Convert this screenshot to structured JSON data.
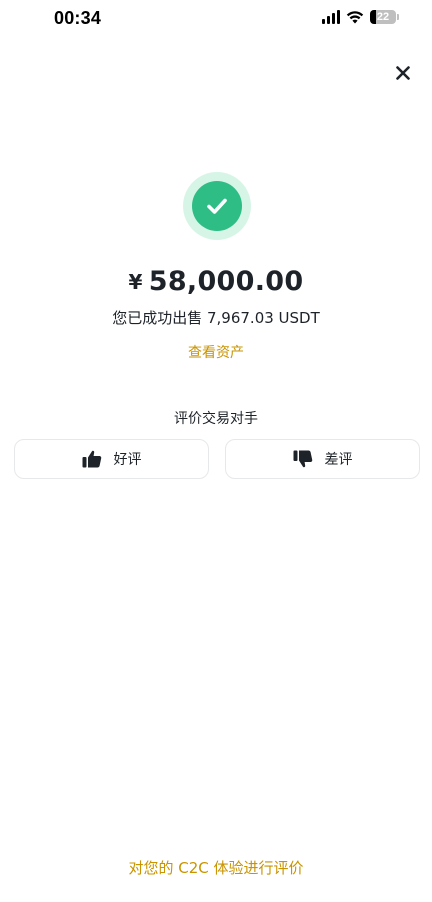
{
  "status_bar": {
    "time": "00:34",
    "battery": "22",
    "battery_level_percent": 22
  },
  "icons": {
    "close": "close-icon",
    "success": "check-circle-icon",
    "good": "thumbs-up-icon",
    "bad": "thumbs-down-icon"
  },
  "colors": {
    "success_green": "#2ebd85",
    "success_halo": "#d7f5e7",
    "accent_gold": "#c99400",
    "text_primary": "#1e2329",
    "border": "#e6e8ea"
  },
  "result": {
    "currency_symbol": "¥",
    "amount": "58,000.00",
    "message": "您已成功出售 7,967.03 USDT",
    "view_assets": "查看资产"
  },
  "rating": {
    "title": "评价交易对手",
    "good_label": "好评",
    "bad_label": "差评"
  },
  "footer": {
    "link": "对您的 C2C 体验进行评价"
  }
}
